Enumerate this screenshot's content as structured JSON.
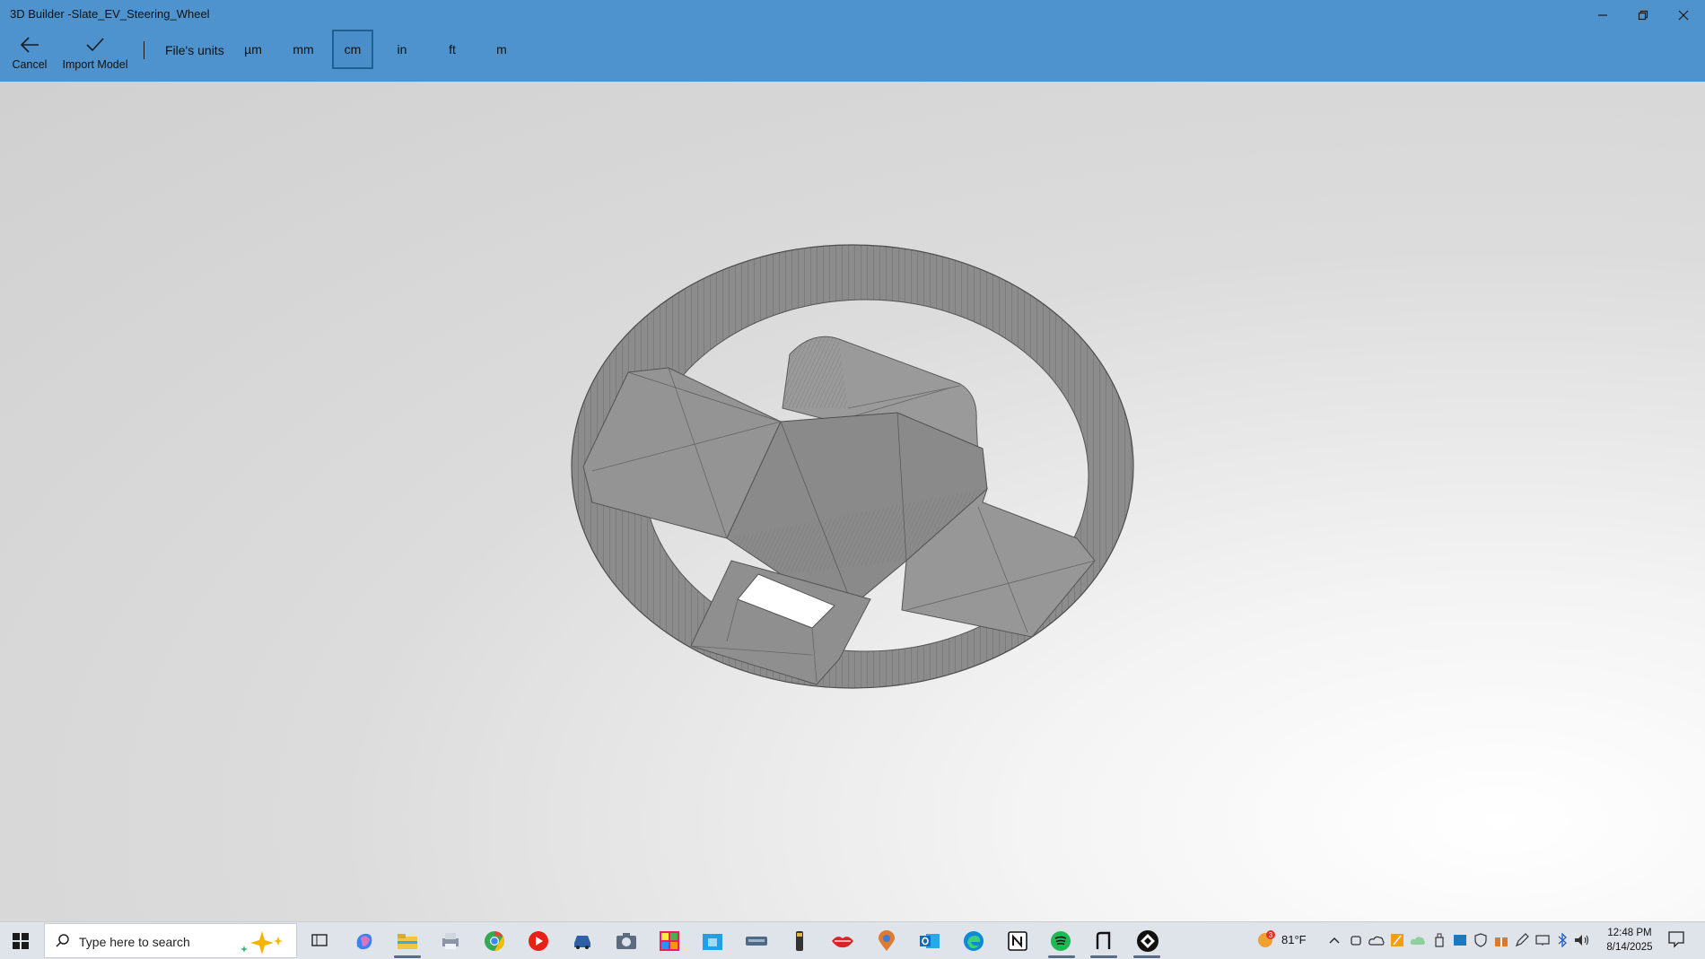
{
  "window": {
    "title": "3D Builder -Slate_EV_Steering_Wheel",
    "controls": [
      "minimize",
      "restore",
      "close"
    ]
  },
  "toolbar": {
    "cancel_label": "Cancel",
    "import_label": "Import Model",
    "units_label": "File's units",
    "units": [
      "µm",
      "mm",
      "cm",
      "in",
      "ft",
      "m"
    ],
    "selected_unit": "cm"
  },
  "viewport": {
    "model": "steering wheel mesh",
    "colors": {
      "mesh_fill": "#8e8e8e",
      "mesh_lines": "#5f5f5f",
      "background_light": "#ffffff",
      "background_dark": "#d0d0d0"
    }
  },
  "taskbar": {
    "search_placeholder": "Type here to search",
    "apps": [
      "task-view",
      "copilot",
      "file-explorer",
      "printer-app",
      "chrome",
      "youtube-music",
      "car-app",
      "camera",
      "tiles-app",
      "store-app",
      "keyboard-app",
      "flashlight-app",
      "lips-app",
      "maps-app",
      "outlook",
      "edge",
      "notion",
      "spotify",
      "text-app",
      "3d-builder"
    ],
    "weather": {
      "temp": "81°F",
      "badge": "3"
    },
    "clock": {
      "time": "12:48 PM",
      "date": "8/14/2025"
    }
  },
  "colors": {
    "accent": "#4e93cd",
    "selected_unit_border": "#1f5f91",
    "taskbar": "#dfe3ea"
  }
}
